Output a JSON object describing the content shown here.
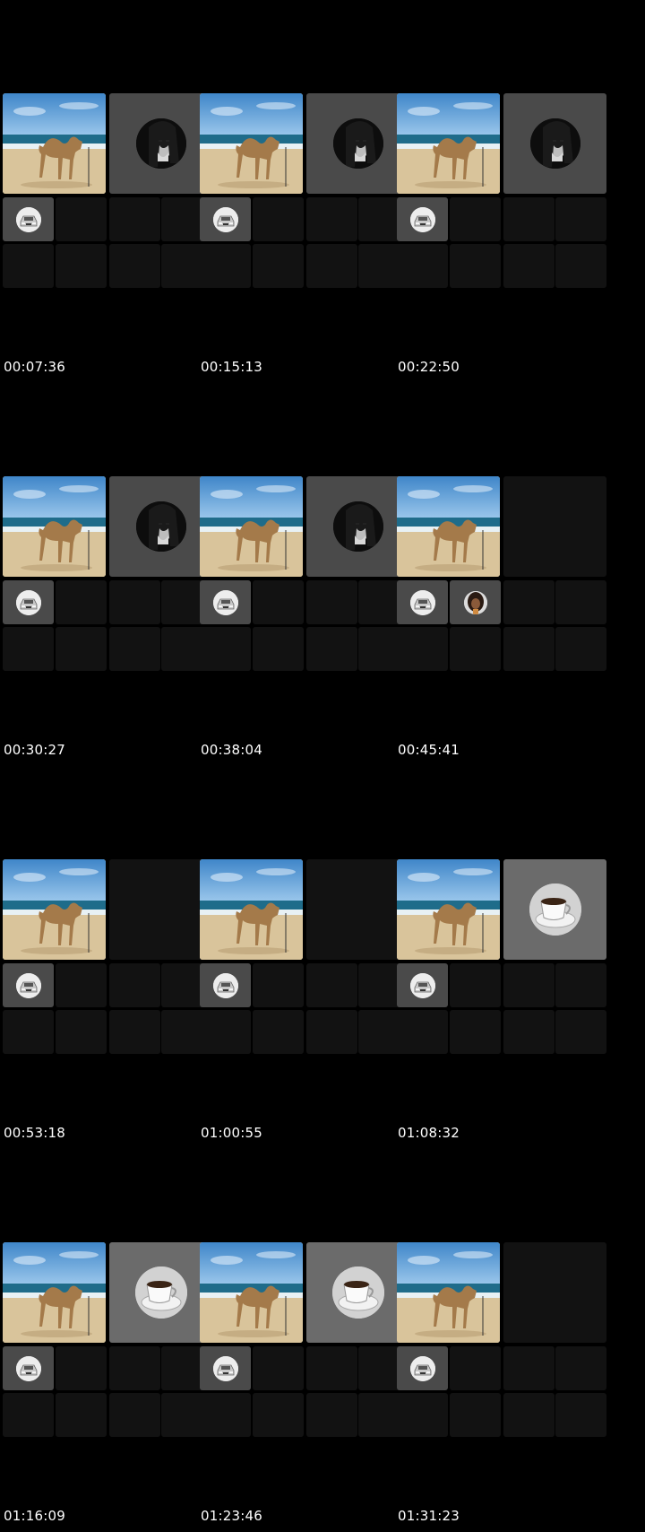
{
  "timestamps": [
    "00:07:36",
    "00:15:13",
    "00:22:50",
    "00:30:27",
    "00:38:04",
    "00:45:41",
    "00:53:18",
    "01:00:55",
    "01:08:32",
    "01:16:09",
    "01:23:46",
    "01:31:23"
  ],
  "frames": [
    {
      "main_thumb": "camel-beach",
      "second_tile": "man-portrait",
      "small_tiles": [
        "car"
      ]
    },
    {
      "main_thumb": "camel-beach",
      "second_tile": "man-portrait",
      "small_tiles": [
        "car"
      ]
    },
    {
      "main_thumb": "camel-beach",
      "second_tile": "man-portrait",
      "small_tiles": [
        "car"
      ]
    },
    {
      "main_thumb": "camel-beach",
      "second_tile": "man-portrait",
      "small_tiles": [
        "car"
      ]
    },
    {
      "main_thumb": "camel-beach",
      "second_tile": "man-portrait",
      "small_tiles": [
        "car"
      ]
    },
    {
      "main_thumb": "camel-beach",
      "second_tile": "empty",
      "small_tiles": [
        "car",
        "woman-portrait"
      ]
    },
    {
      "main_thumb": "camel-beach",
      "second_tile": "empty",
      "small_tiles": [
        "car"
      ]
    },
    {
      "main_thumb": "camel-beach",
      "second_tile": "empty",
      "small_tiles": [
        "car"
      ]
    },
    {
      "main_thumb": "camel-beach",
      "second_tile": "coffee-cup",
      "small_tiles": [
        "car"
      ]
    },
    {
      "main_thumb": "camel-beach",
      "second_tile": "coffee-cup",
      "small_tiles": [
        "car"
      ]
    },
    {
      "main_thumb": "camel-beach",
      "second_tile": "coffee-cup",
      "small_tiles": [
        "car"
      ]
    },
    {
      "main_thumb": "camel-beach",
      "second_tile": "empty",
      "small_tiles": [
        "car"
      ]
    }
  ]
}
